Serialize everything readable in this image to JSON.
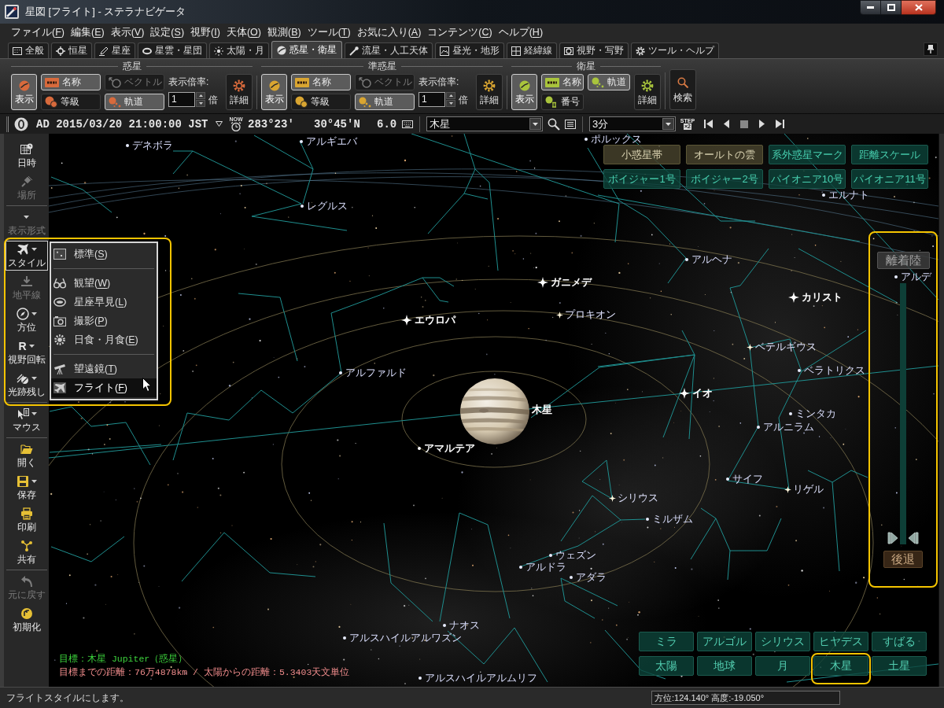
{
  "window": {
    "title": "星図 [フライト] - ステラナビゲータ"
  },
  "menu": [
    "ファイル(F)",
    "編集(E)",
    "表示(V)",
    "設定(S)",
    "視野(I)",
    "天体(O)",
    "観測(B)",
    "ツール(T)",
    "お気に入り(A)",
    "コンテンツ(C)",
    "ヘルプ(H)"
  ],
  "tabs": [
    {
      "label": "全般",
      "selected": false
    },
    {
      "label": "恒星",
      "selected": false
    },
    {
      "label": "星座",
      "selected": false
    },
    {
      "label": "星雲・星団",
      "selected": false
    },
    {
      "label": "太陽・月",
      "selected": false
    },
    {
      "label": "惑星・衛星",
      "selected": true
    },
    {
      "label": "流星・人工天体",
      "selected": false
    },
    {
      "label": "昼光・地形",
      "selected": false
    },
    {
      "label": "経緯線",
      "selected": false
    },
    {
      "label": "視野・写野",
      "selected": false
    },
    {
      "label": "ツール・ヘルプ",
      "selected": false
    }
  ],
  "ribbon": {
    "groups": [
      {
        "title": "惑星",
        "color": "#d86a3c",
        "show": {
          "label": "表示",
          "on": true
        },
        "toggles": [
          {
            "kind": "name",
            "label": "名称",
            "on": true,
            "disabled": false
          },
          {
            "kind": "magnitude",
            "label": "等級",
            "on": false,
            "disabled": false
          },
          {
            "kind": "vector",
            "label": "ベクトル",
            "on": false,
            "disabled": true
          },
          {
            "kind": "orbit",
            "label": "軌道",
            "on": true,
            "disabled": false
          }
        ],
        "scale": {
          "label": "表示倍率:",
          "value": "1",
          "unit": "倍"
        },
        "detail": "詳細"
      },
      {
        "title": "準惑星",
        "color": "#d9a531",
        "show": {
          "label": "表示",
          "on": true
        },
        "toggles": [
          {
            "kind": "name",
            "label": "名称",
            "on": true,
            "disabled": false
          },
          {
            "kind": "magnitude",
            "label": "等級",
            "on": false,
            "disabled": false
          },
          {
            "kind": "vector",
            "label": "ベクトル",
            "on": false,
            "disabled": true
          },
          {
            "kind": "orbit",
            "label": "軌道",
            "on": true,
            "disabled": false
          }
        ],
        "scale": {
          "label": "表示倍率:",
          "value": "1",
          "unit": "倍"
        },
        "detail": "詳細"
      },
      {
        "title": "衛星",
        "color": "#a9c43c",
        "show": {
          "label": "表示",
          "on": true
        },
        "toggles": [
          {
            "kind": "name",
            "label": "名称",
            "on": true,
            "disabled": false
          },
          {
            "kind": "number",
            "label": "番号",
            "on": false,
            "disabled": false
          },
          {
            "kind": "orbit",
            "label": "軌道",
            "on": true,
            "disabled": false
          }
        ],
        "detail": "詳細"
      }
    ],
    "search": "検索"
  },
  "toolbar": {
    "date": "AD 2015/03/20 21:00:00 JST",
    "now": "NOW",
    "azimuth": "283°23'",
    "latitude": "30°45'N",
    "magnitude": "6.0",
    "target": "木星",
    "step": "3分",
    "step_label": "STEP",
    "step_factor": "×2"
  },
  "sidebar": {
    "sections": [
      [
        {
          "label": "日時",
          "disabled": false,
          "dropdown": false,
          "expanded": false
        },
        {
          "label": "場所",
          "disabled": true,
          "dropdown": false,
          "expanded": false
        }
      ],
      [
        {
          "label": "表示形式",
          "disabled": true,
          "dropdown": true,
          "expanded": false
        },
        {
          "label": "スタイル",
          "disabled": false,
          "dropdown": true,
          "expanded": true
        },
        {
          "label": "地平線",
          "disabled": true,
          "dropdown": false,
          "expanded": false
        },
        {
          "label": "方位",
          "disabled": false,
          "dropdown": true,
          "expanded": false
        },
        {
          "label": "視野回転",
          "glyph": "R",
          "disabled": false,
          "dropdown": true,
          "expanded": false
        },
        {
          "label": "光跡残し",
          "disabled": false,
          "dropdown": true,
          "expanded": false
        }
      ],
      [
        {
          "label": "マウス",
          "disabled": false,
          "dropdown": true,
          "expanded": false
        }
      ],
      [
        {
          "label": "開く",
          "disabled": false,
          "dropdown": false,
          "expanded": false
        },
        {
          "label": "保存",
          "disabled": false,
          "dropdown": true,
          "expanded": false
        },
        {
          "label": "印刷",
          "disabled": false,
          "dropdown": false,
          "expanded": false
        },
        {
          "label": "共有",
          "disabled": false,
          "dropdown": false,
          "expanded": false
        }
      ],
      [
        {
          "label": "元に戻す",
          "disabled": true,
          "dropdown": false,
          "expanded": false
        },
        {
          "label": "初期化",
          "disabled": false,
          "dropdown": false,
          "expanded": false
        }
      ]
    ]
  },
  "style_menu": {
    "highlighted": true,
    "sections": [
      [
        {
          "label": "標準(S)",
          "selected": false
        }
      ],
      [
        {
          "label": "観望(W)",
          "selected": false
        },
        {
          "label": "星座早見(L)",
          "selected": false
        },
        {
          "label": "撮影(P)",
          "selected": false
        },
        {
          "label": "日食・月食(E)",
          "selected": false
        }
      ],
      [
        {
          "label": "望遠鏡(T)",
          "selected": false
        },
        {
          "label": "フライト(F)",
          "selected": true
        }
      ]
    ]
  },
  "sky": {
    "labels": [
      {
        "text": "デネボラ",
        "kind": "star"
      },
      {
        "text": "アルギエバ",
        "kind": "star"
      },
      {
        "text": "ポルックス",
        "kind": "star"
      },
      {
        "text": "レグルス",
        "kind": "star"
      },
      {
        "text": "エルナト",
        "kind": "star"
      },
      {
        "text": "アルヘナ",
        "kind": "star"
      },
      {
        "text": "ガニメデ",
        "kind": "moon"
      },
      {
        "text": "カリスト",
        "kind": "moon"
      },
      {
        "text": "アルデ",
        "kind": "star"
      },
      {
        "text": "エウロパ",
        "kind": "moon"
      },
      {
        "text": "プロキオン",
        "kind": "bright_star"
      },
      {
        "text": "ベテルギウス",
        "kind": "bright_star"
      },
      {
        "text": "ベラトリクス",
        "kind": "star"
      },
      {
        "text": "アルファルド",
        "kind": "star"
      },
      {
        "text": "イオ",
        "kind": "moon"
      },
      {
        "text": "木星",
        "kind": "planet"
      },
      {
        "text": "ミンタカ",
        "kind": "star"
      },
      {
        "text": "アルニラム",
        "kind": "star"
      },
      {
        "text": "アマルテア",
        "kind": "minor_moon"
      },
      {
        "text": "サイフ",
        "kind": "star"
      },
      {
        "text": "リゲル",
        "kind": "bright_star"
      },
      {
        "text": "シリウス",
        "kind": "bright_star"
      },
      {
        "text": "ミルザム",
        "kind": "star"
      },
      {
        "text": "ウェズン",
        "kind": "star"
      },
      {
        "text": "アルドラ",
        "kind": "star"
      },
      {
        "text": "アダラ",
        "kind": "star"
      },
      {
        "text": "ナオス",
        "kind": "star"
      },
      {
        "text": "アルスハイルアルワズン",
        "kind": "star"
      },
      {
        "text": "アルスハイルアルムリフ",
        "kind": "star"
      }
    ]
  },
  "overlay_buttons": [
    {
      "label": "小惑星帯",
      "on": true
    },
    {
      "label": "オールトの雲",
      "on": true
    },
    {
      "label": "系外惑星マーク",
      "on": false
    },
    {
      "label": "距離スケール",
      "on": false
    },
    {
      "label": "ボイジャー1号",
      "on": false
    },
    {
      "label": "ボイジャー2号",
      "on": false
    },
    {
      "label": "パイオニア10号",
      "on": false
    },
    {
      "label": "パイオニア11号",
      "on": false
    }
  ],
  "flight_panel": {
    "highlighted": true,
    "land_button": "離着陸",
    "speed": {
      "level": 0
    },
    "back_button": "後退"
  },
  "jump_buttons": [
    {
      "label": "ミラ",
      "highlighted": false
    },
    {
      "label": "アルゴル",
      "highlighted": false
    },
    {
      "label": "シリウス",
      "highlighted": false
    },
    {
      "label": "ヒヤデス",
      "highlighted": false
    },
    {
      "label": "すばる",
      "highlighted": false
    },
    {
      "label": "太陽",
      "highlighted": false
    },
    {
      "label": "地球",
      "highlighted": false
    },
    {
      "label": "月",
      "highlighted": false
    },
    {
      "label": "木星",
      "highlighted": true
    },
    {
      "label": "土星",
      "highlighted": false
    }
  ],
  "info_lines": [
    {
      "text": "目標：木星 Jupiter（惑星）",
      "color": "#3cd23c"
    },
    {
      "text": "目標までの距離：76万4878km / 太陽からの距離：5.3403天文単位",
      "color": "#f08c8c"
    }
  ],
  "status_bar": {
    "message": "フライトスタイルにします。",
    "coordinates": "方位:124.140° 高度:-19.050°"
  }
}
